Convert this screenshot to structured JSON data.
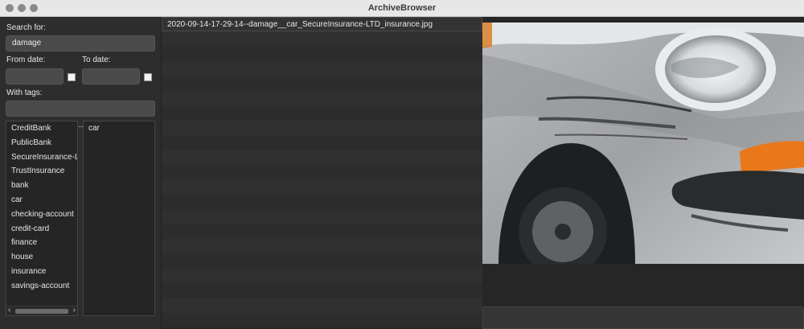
{
  "window": {
    "title": "ArchiveBrowser"
  },
  "search": {
    "label": "Search for:",
    "value": "damage"
  },
  "dates": {
    "from_label": "From date:",
    "to_label": "To date:"
  },
  "tags_filter": {
    "label": "With tags:",
    "value": ""
  },
  "tags": {
    "all": [
      "CreditBank",
      "PublicBank",
      "SecureInsurance-LT",
      "TrustInsurance",
      "bank",
      "car",
      "checking-account",
      "credit-card",
      "finance",
      "house",
      "insurance",
      "savings-account"
    ],
    "splitter_glyph": "--",
    "selected": [
      "car"
    ]
  },
  "scrollbar": {
    "left_arrow": "‹",
    "right_arrow": "›"
  },
  "files": [
    "2020-09-14-17-29-14--damage__car_SecureInsurance-LTD_insurance.jpg"
  ]
}
